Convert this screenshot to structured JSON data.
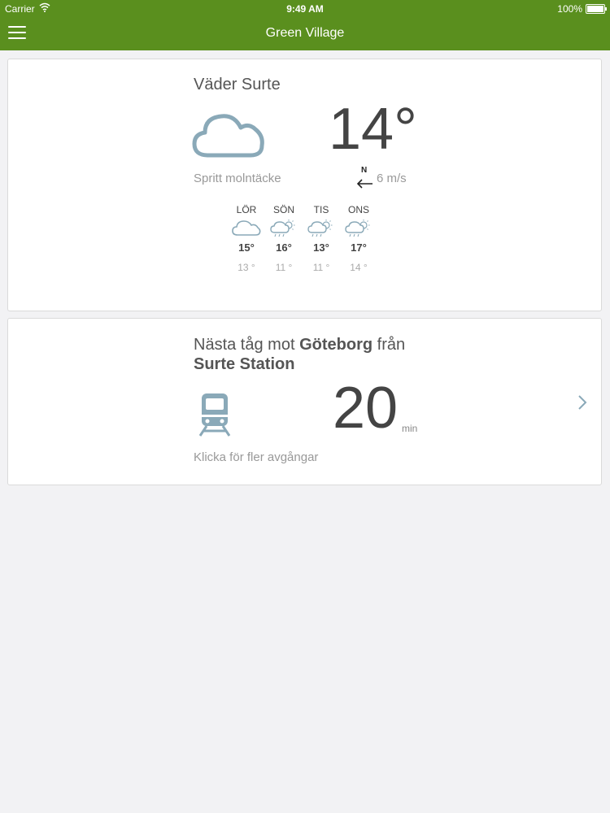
{
  "status_bar": {
    "carrier": "Carrier",
    "time": "9:49 AM",
    "battery": "100%"
  },
  "app": {
    "title": "Green Village",
    "accent_color": "#5a8f1e"
  },
  "weather": {
    "title": "Väder Surte",
    "icon": "cloud-icon",
    "temperature": "14°",
    "description": "Spritt molntäcke",
    "wind": {
      "direction_label": "N",
      "direction": "west",
      "speed": "6 m/s"
    },
    "forecast": [
      {
        "day": "LÖR",
        "icon": "cloud-icon",
        "high": "15°",
        "low": "13 °"
      },
      {
        "day": "SÖN",
        "icon": "cloud-sun-rain-icon",
        "high": "16°",
        "low": "11 °"
      },
      {
        "day": "TIS",
        "icon": "cloud-sun-rain-icon",
        "high": "13°",
        "low": "11 °"
      },
      {
        "day": "ONS",
        "icon": "cloud-sun-rain-icon",
        "high": "17°",
        "low": "14 °"
      }
    ]
  },
  "train": {
    "title_prefix": "Nästa tåg mot",
    "destination": "Göteborg",
    "title_mid": "från",
    "station": "Surte Station",
    "icon": "train-icon",
    "minutes": "20",
    "unit": "min",
    "more_label": "Klicka för fler avgångar"
  }
}
